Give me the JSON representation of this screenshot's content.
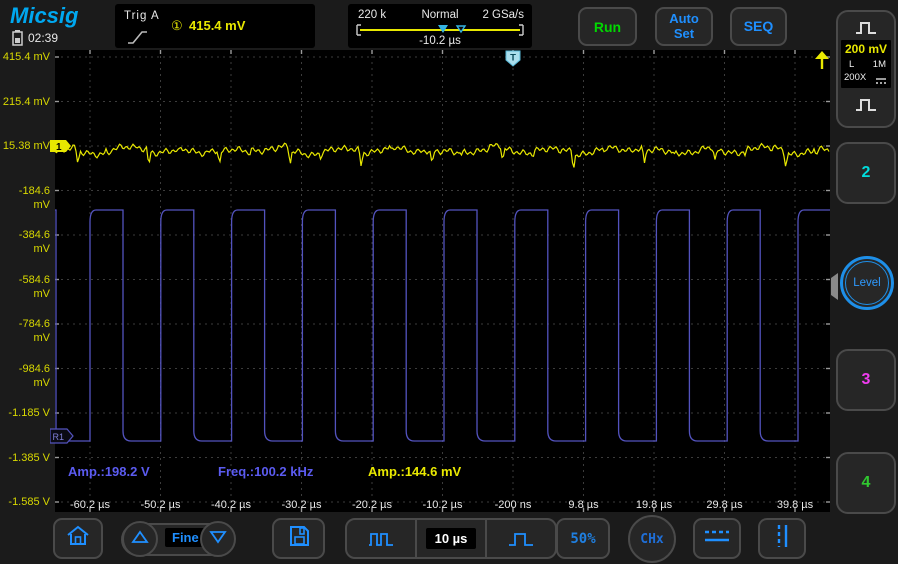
{
  "header": {
    "logo": "Micsig",
    "time": "02:39",
    "trigger": {
      "label": "Trig A",
      "source_badge": "①",
      "level": "415.4 mV"
    },
    "acquisition": {
      "depth": "220 k",
      "mode": "Normal",
      "sample_rate": "2 GSa/s",
      "delay": "-10.2 µs"
    },
    "buttons": {
      "run": "Run",
      "auto_set": "Auto Set",
      "seq": "SEQ"
    }
  },
  "sidebar": {
    "ch1": {
      "scale": "200 mV",
      "coupling": "L",
      "impedance": "1M",
      "probe": "200X"
    },
    "ch2_label": "2",
    "level_label": "Level",
    "ch3_label": "3",
    "ch4_label": "4",
    "colors": {
      "ch1": "#e8e800",
      "ch2": "#00dcdc",
      "ch3": "#f03cf0",
      "ch4": "#30c830",
      "ref": "#5353be",
      "accent_blue": "#1f8fff"
    }
  },
  "toolbar": {
    "fine": "Fine",
    "timebase": "10 µs",
    "percent": "50%",
    "chx": "CHx"
  },
  "plot": {
    "markers": {
      "trigger_marker": "T",
      "ch1_flag": "1",
      "ref_flag": "R1"
    }
  },
  "chart_data": {
    "type": "line",
    "title": "Oscilloscope trace display",
    "x_axis": {
      "tick_labels": [
        "-60.2 µs",
        "-50.2 µs",
        "-40.2 µs",
        "-30.2 µs",
        "-20.2 µs",
        "-10.2 µs",
        "-200 ns",
        "9.8 µs",
        "19.8 µs",
        "29.8 µs",
        "39.8 µs"
      ],
      "time_per_div": "10 µs",
      "trigger_delay": "-10.2 µs",
      "grid": "10 divisions, dashed"
    },
    "y_axis": {
      "tick_labels": [
        "415.4 mV",
        "215.4 mV",
        "15.38 mV",
        "-184.6 mV",
        "-384.6 mV",
        "-584.6 mV",
        "-784.6 mV",
        "-984.6 mV",
        "-1.185 V",
        "-1.385 V",
        "-1.585 V"
      ],
      "volts_per_div": "200 mV"
    },
    "series": [
      {
        "name": "CH1",
        "color": "#e8e800",
        "kind": "noisy flat trace with periodic downward glitches",
        "level": "15.38 mV",
        "amplitude": "144.6 mV"
      },
      {
        "name": "R1",
        "color": "#5353be",
        "kind": "square wave",
        "frequency": "100.2 kHz",
        "amplitude": "198.2 V",
        "high_level_approx": "-290 mV",
        "low_level_approx": "-1.25 V",
        "duty_cycle_pct": 45
      }
    ],
    "measurements": [
      {
        "text": "Amp.:198.2 V",
        "color": "#5b5bf0"
      },
      {
        "text": "Freq.:100.2 kHz",
        "color": "#5b5bf0"
      },
      {
        "text": "Amp.:144.6 mV",
        "color": "#e8e800"
      }
    ]
  }
}
